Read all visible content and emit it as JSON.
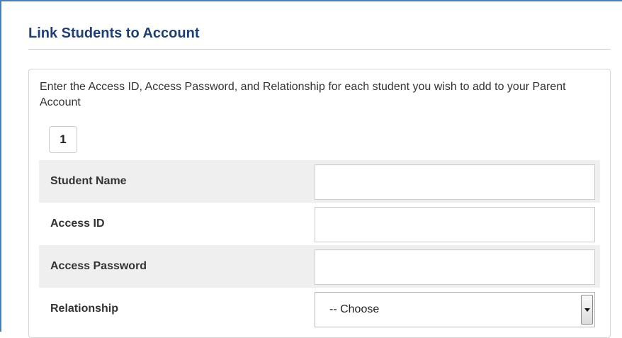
{
  "page": {
    "title": "Link Students to Account",
    "instructions": "Enter the Access ID, Access Password, and Relationship for each student you wish to add to your Parent Account",
    "step_number": "1"
  },
  "form": {
    "student_name": {
      "label": "Student Name",
      "value": ""
    },
    "access_id": {
      "label": "Access ID",
      "value": ""
    },
    "access_password": {
      "label": "Access Password",
      "value": ""
    },
    "relationship": {
      "label": "Relationship",
      "selected": "-- Choose"
    }
  },
  "icons": {
    "select_arrow": "chevron-down-icon"
  },
  "colors": {
    "title": "#1e3f74",
    "frame_border": "#4a7fb5",
    "shaded_row": "#efefef"
  }
}
